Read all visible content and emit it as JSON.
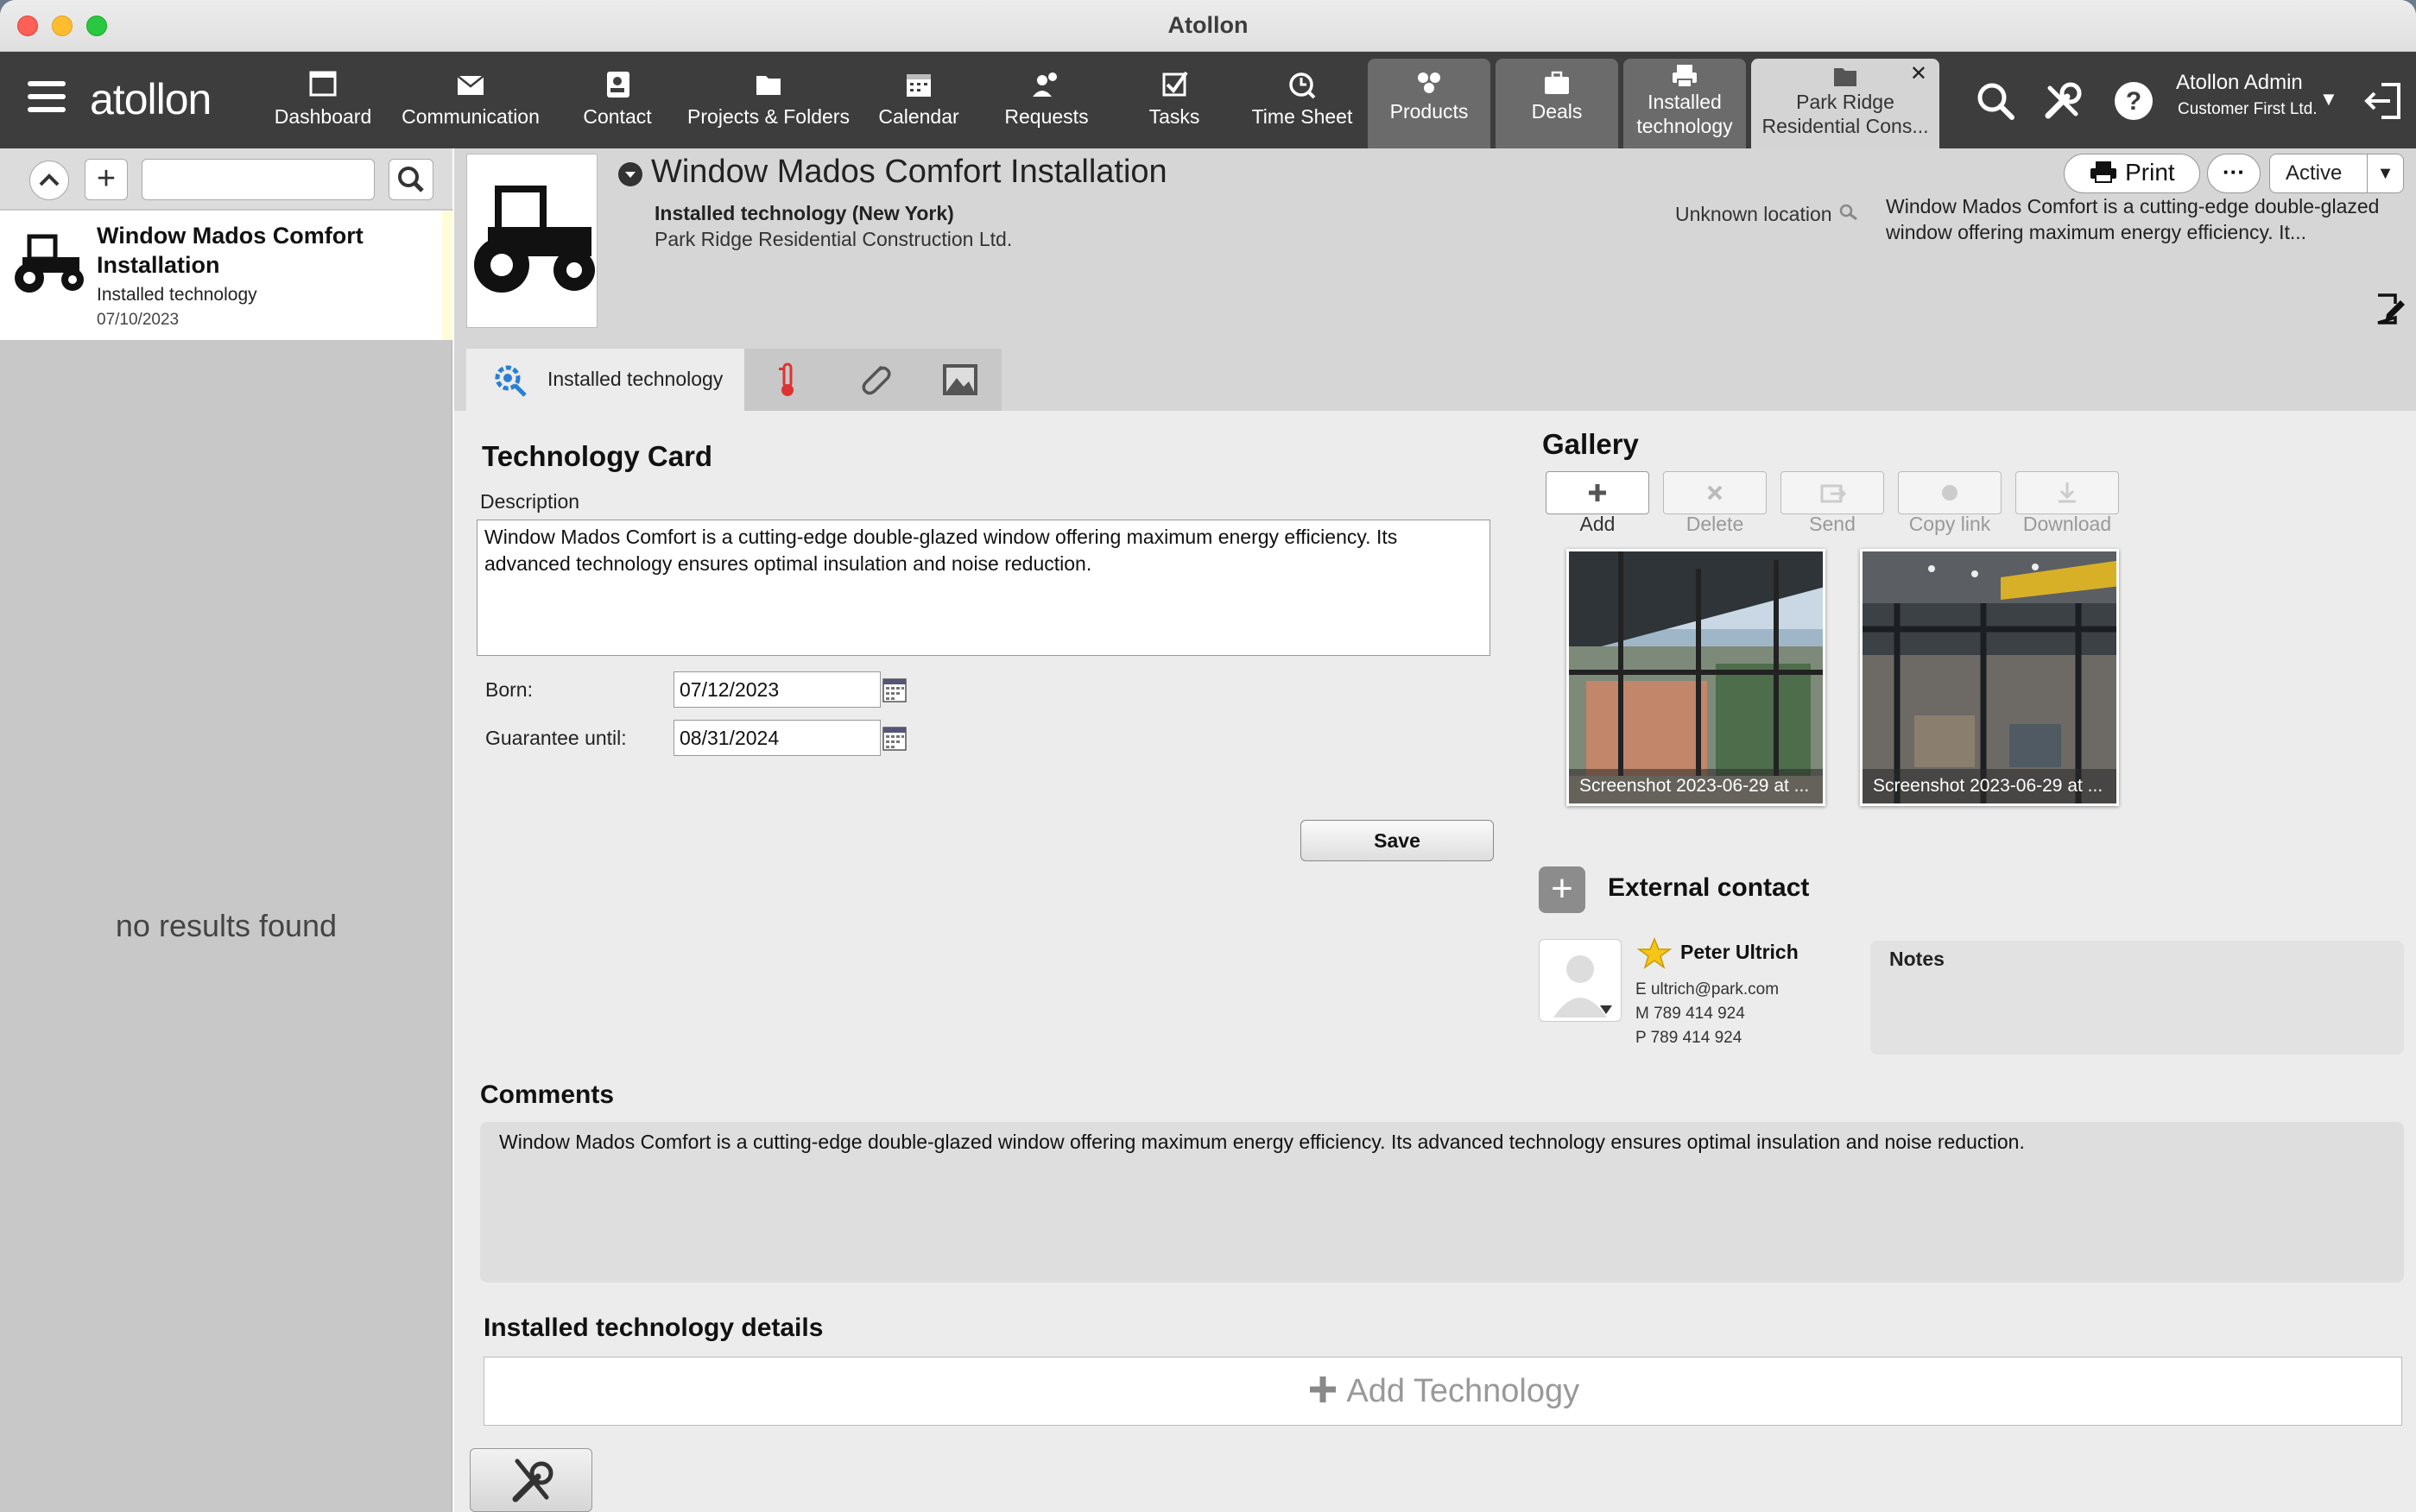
{
  "window": {
    "title": "Atollon"
  },
  "toolbar": {
    "logo": "atollon",
    "nav": [
      {
        "label": "Dashboard",
        "icon": "dashboard-icon"
      },
      {
        "label": "Communication",
        "icon": "envelope-icon"
      },
      {
        "label": "Contact",
        "icon": "contact-card-icon"
      },
      {
        "label": "Projects & Folders",
        "icon": "folder-icon"
      },
      {
        "label": "Calendar",
        "icon": "calendar-icon"
      },
      {
        "label": "Requests",
        "icon": "people-icon"
      },
      {
        "label": "Tasks",
        "icon": "checkbox-icon"
      },
      {
        "label": "Time Sheet",
        "icon": "stopwatch-icon"
      }
    ],
    "tabs": [
      {
        "label": "Products",
        "icon": "products-icon"
      },
      {
        "label": "Deals",
        "icon": "briefcase-icon"
      },
      {
        "label_line1": "Installed",
        "label_line2": "technology",
        "icon": "printer-icon"
      },
      {
        "label_line1": "Park Ridge",
        "label_line2": "Residential Cons...",
        "icon": "folder-icon",
        "close": "✕"
      }
    ],
    "user": {
      "name": "Atollon Admin",
      "org": "Customer First Ltd.",
      "caret": "▼"
    }
  },
  "sidebar": {
    "item": {
      "title": "Window Mados Comfort Installation",
      "subtitle": "Installed technology",
      "date": "07/10/2023"
    },
    "empty_text": "no results found"
  },
  "header": {
    "title": "Window Mados Comfort Installation",
    "subtitle": "Installed technology (New York)",
    "company": "Park Ridge Residential Construction Ltd.",
    "location": "Unknown location",
    "description_preview": "Window Mados Comfort is a cutting-edge double-glazed window offering maximum energy efficiency. It...",
    "print_label": "Print",
    "more_label": "···",
    "status": "Active"
  },
  "tabs": [
    {
      "label": "Installed technology",
      "icon": "gear-search-icon"
    },
    {
      "label": "",
      "icon": "thermometer-icon"
    },
    {
      "label": "",
      "icon": "paperclip-icon"
    },
    {
      "label": "",
      "icon": "image-icon"
    }
  ],
  "card": {
    "title": "Technology Card",
    "description_label": "Description",
    "description": "Window Mados Comfort is a cutting-edge double-glazed window offering maximum energy efficiency. Its advanced technology ensures optimal insulation and noise reduction.",
    "born_label": "Born:",
    "born": "07/12/2023",
    "guarantee_label": "Guarantee until:",
    "guarantee": "08/31/2024",
    "save_label": "Save"
  },
  "gallery": {
    "title": "Gallery",
    "buttons": [
      "Add",
      "Delete",
      "Send",
      "Copy link",
      "Download"
    ],
    "photos": [
      {
        "caption": "Screenshot 2023-06-29 at ..."
      },
      {
        "caption": "Screenshot 2023-06-29 at ..."
      }
    ]
  },
  "external_contact": {
    "title": "External contact",
    "name": "Peter Ultrich",
    "email": "E ultrich@park.com",
    "mobile": "M 789 414 924",
    "phone": "P 789 414 924",
    "notes_label": "Notes"
  },
  "comments": {
    "title": "Comments",
    "text": "Window Mados Comfort is a cutting-edge double-glazed window offering maximum energy efficiency. Its advanced technology ensures optimal insulation and noise reduction."
  },
  "details": {
    "title": "Installed technology details",
    "add_label": "Add Technology"
  },
  "colors": {
    "toolbar": "#3d3d3d",
    "accent_blue": "#2a7fd4",
    "selection": "#fffcd8",
    "star": "#f5c518"
  }
}
